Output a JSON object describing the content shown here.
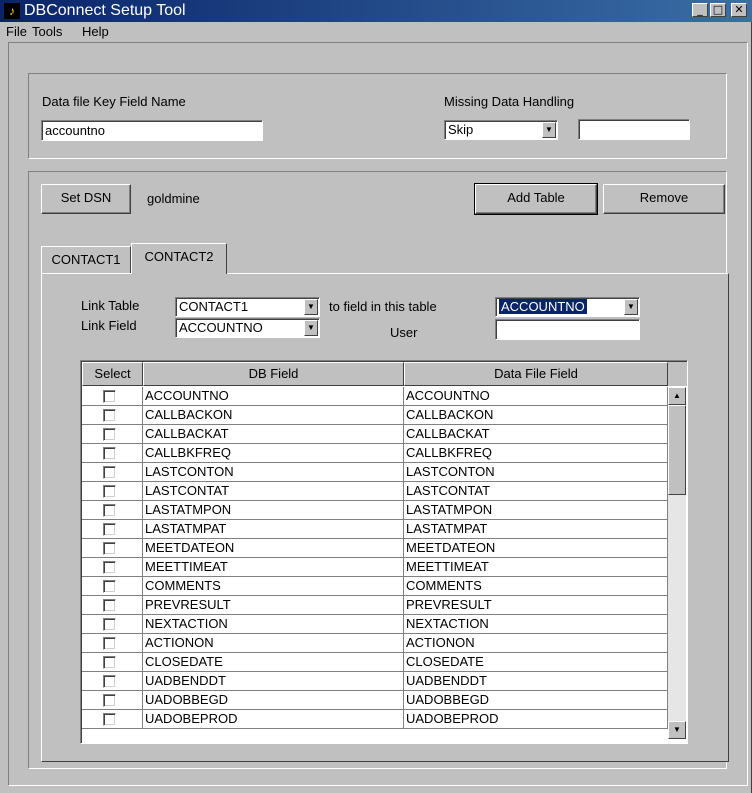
{
  "window": {
    "title": "DBConnect Setup Tool",
    "minimize": "_",
    "maximize": "□",
    "close": "✕"
  },
  "menu": [
    "File",
    "Tools",
    "Help"
  ],
  "key_section": {
    "key_field_label": "Data file Key Field Name",
    "key_field_value": "accountno",
    "missing_label": "Missing Data Handling",
    "missing_value": "Skip",
    "missing_extra_value": ""
  },
  "dsn": {
    "set_dsn_label": "Set DSN",
    "dsn_value": "goldmine",
    "add_table_label": "Add Table",
    "remove_label": "Remove"
  },
  "tabs": [
    "CONTACT1",
    "CONTACT2"
  ],
  "link": {
    "link_table_label": "Link Table",
    "link_table_value": "CONTACT1",
    "to_field_label": "to field in this table",
    "to_field_value": "ACCOUNTNO",
    "link_field_label": "Link Field",
    "link_field_value": "ACCOUNTNO",
    "user_label": "User",
    "user_value": ""
  },
  "table": {
    "columns": [
      "Select",
      "DB Field",
      "Data File Field"
    ],
    "rows": [
      {
        "db": "ACCOUNTNO",
        "file": "ACCOUNTNO"
      },
      {
        "db": "CALLBACKON",
        "file": "CALLBACKON"
      },
      {
        "db": "CALLBACKAT",
        "file": "CALLBACKAT"
      },
      {
        "db": "CALLBKFREQ",
        "file": "CALLBKFREQ"
      },
      {
        "db": "LASTCONTON",
        "file": "LASTCONTON"
      },
      {
        "db": "LASTCONTAT",
        "file": "LASTCONTAT"
      },
      {
        "db": "LASTATMPON",
        "file": "LASTATMPON"
      },
      {
        "db": "LASTATMPAT",
        "file": "LASTATMPAT"
      },
      {
        "db": "MEETDATEON",
        "file": "MEETDATEON"
      },
      {
        "db": "MEETTIMEAT",
        "file": "MEETTIMEAT"
      },
      {
        "db": "COMMENTS",
        "file": "COMMENTS"
      },
      {
        "db": "PREVRESULT",
        "file": "PREVRESULT"
      },
      {
        "db": "NEXTACTION",
        "file": "NEXTACTION"
      },
      {
        "db": "ACTIONON",
        "file": "ACTIONON"
      },
      {
        "db": "CLOSEDATE",
        "file": "CLOSEDATE"
      },
      {
        "db": "UADBENDDT",
        "file": "UADBENDDT"
      },
      {
        "db": "UADOBBEGD",
        "file": "UADOBBEGD"
      },
      {
        "db": "UADOBEPROD",
        "file": "UADOBEPROD"
      }
    ]
  }
}
